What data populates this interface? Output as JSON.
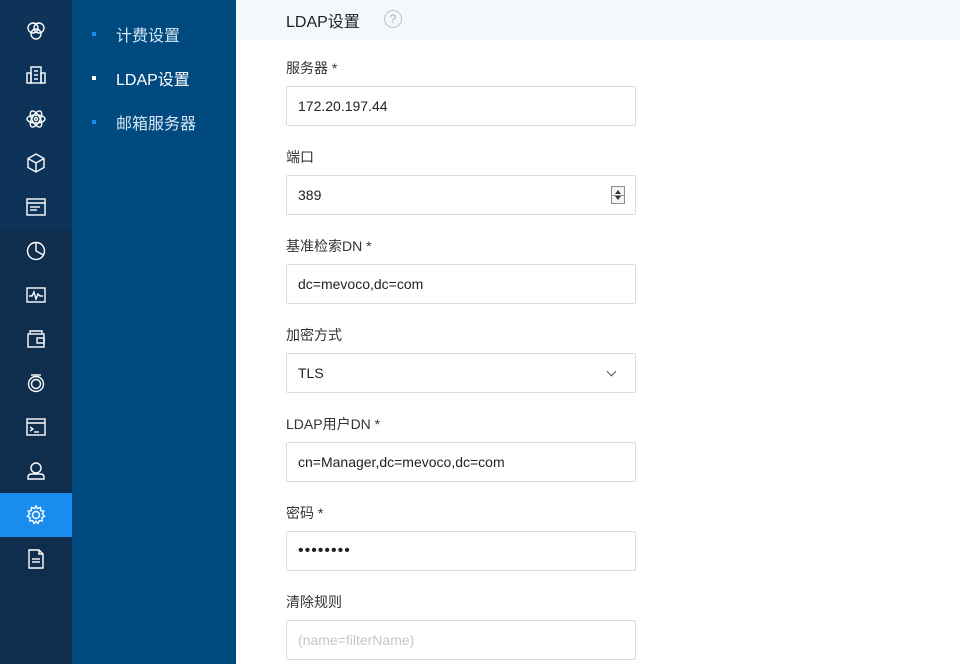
{
  "rail": {
    "items": [
      {
        "icon": "overview-icon"
      },
      {
        "icon": "building-icon"
      },
      {
        "icon": "atom-icon"
      },
      {
        "icon": "cube-icon"
      },
      {
        "icon": "list-window-icon"
      },
      {
        "icon": "pie-chart-icon"
      },
      {
        "icon": "monitor-icon"
      },
      {
        "icon": "wallet-icon"
      },
      {
        "icon": "alarm-icon"
      },
      {
        "icon": "terminal-icon"
      },
      {
        "icon": "user-icon"
      },
      {
        "icon": "gear-icon",
        "active": true
      },
      {
        "icon": "document-icon"
      }
    ]
  },
  "submenu": {
    "items": [
      {
        "label": "计费设置"
      },
      {
        "label": "LDAP设置",
        "active": true
      },
      {
        "label": "邮箱服务器"
      }
    ]
  },
  "header": {
    "title": "LDAP设置",
    "help": "?"
  },
  "form": {
    "server": {
      "label": "服务器 *",
      "value": "172.20.197.44"
    },
    "port": {
      "label": "端口",
      "value": "389"
    },
    "base_dn": {
      "label": "基准检索DN *",
      "value": "dc=mevoco,dc=com"
    },
    "encryption": {
      "label": "加密方式",
      "value": "TLS"
    },
    "user_dn": {
      "label": "LDAP用户DN *",
      "value": "cn=Manager,dc=mevoco,dc=com"
    },
    "password": {
      "label": "密码 *",
      "value": "••••••••"
    },
    "filter": {
      "label": "清除规则",
      "placeholder": "(name=filterName)"
    }
  },
  "colors": {
    "rail_bg": "#0f2d4d",
    "submenu_bg": "#004a80",
    "accent": "#1a8cf0",
    "header_bg": "#f3f8fc"
  }
}
